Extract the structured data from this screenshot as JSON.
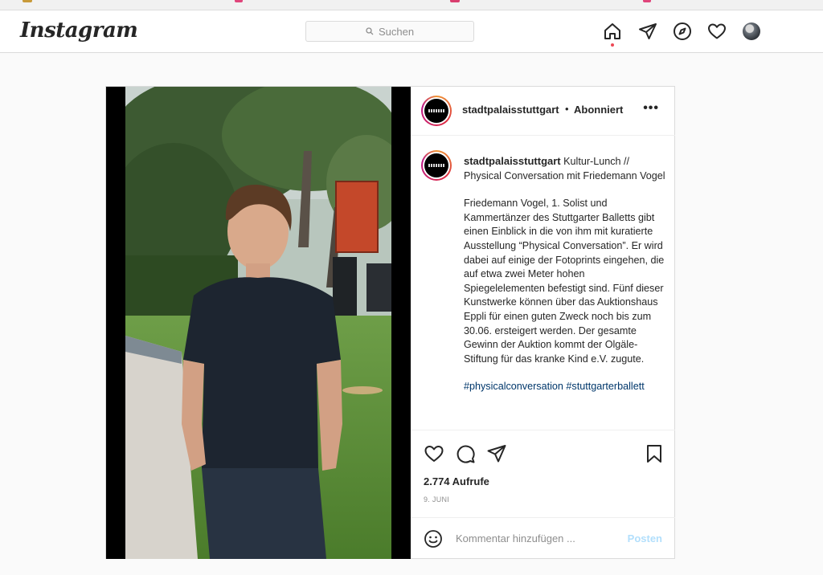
{
  "topbar": {
    "logo": "Instagram",
    "search_placeholder": "Suchen",
    "icons": [
      "home-icon",
      "direct-icon",
      "explore-icon",
      "activity-icon",
      "profile-avatar"
    ]
  },
  "post": {
    "username": "stadtpalaisstuttgart",
    "separator": "•",
    "follow_status": "Abonniert",
    "more": "•••",
    "caption": {
      "username": "stadtpalaisstuttgart",
      "title": " Kultur-Lunch // Physical Conversation mit Friedemann Vogel",
      "body": "Friedemann Vogel, 1. Solist und Kammertänzer des Stuttgarter Balletts gibt einen Einblick in die von ihm mit kuratierte Ausstellung “Physical Conversation”. Er wird dabei auf einige der Fotoprints eingehen, die auf etwa zwei Meter hohen Spiegelelementen befestigt sind. Fünf dieser Kunstwerke können über das Auktionshaus Eppli für einen guten Zweck noch bis zum 30.06. ersteigert werden. Der gesamte Gewinn der Auktion kommt der Olgäle-Stiftung für das kranke Kind e.V. zugute.",
      "hashtags": "#physicalconversation #stuttgarterballett"
    },
    "views": "2.774 Aufrufe",
    "date": "9. JUNI",
    "comment_placeholder": "Kommentar hinzufügen ...",
    "post_button": "Posten"
  },
  "colors": {
    "link": "#00376b",
    "muted": "#8e8e8e",
    "post_button": "#b2dffc",
    "notification_dot": "#ed4956"
  }
}
